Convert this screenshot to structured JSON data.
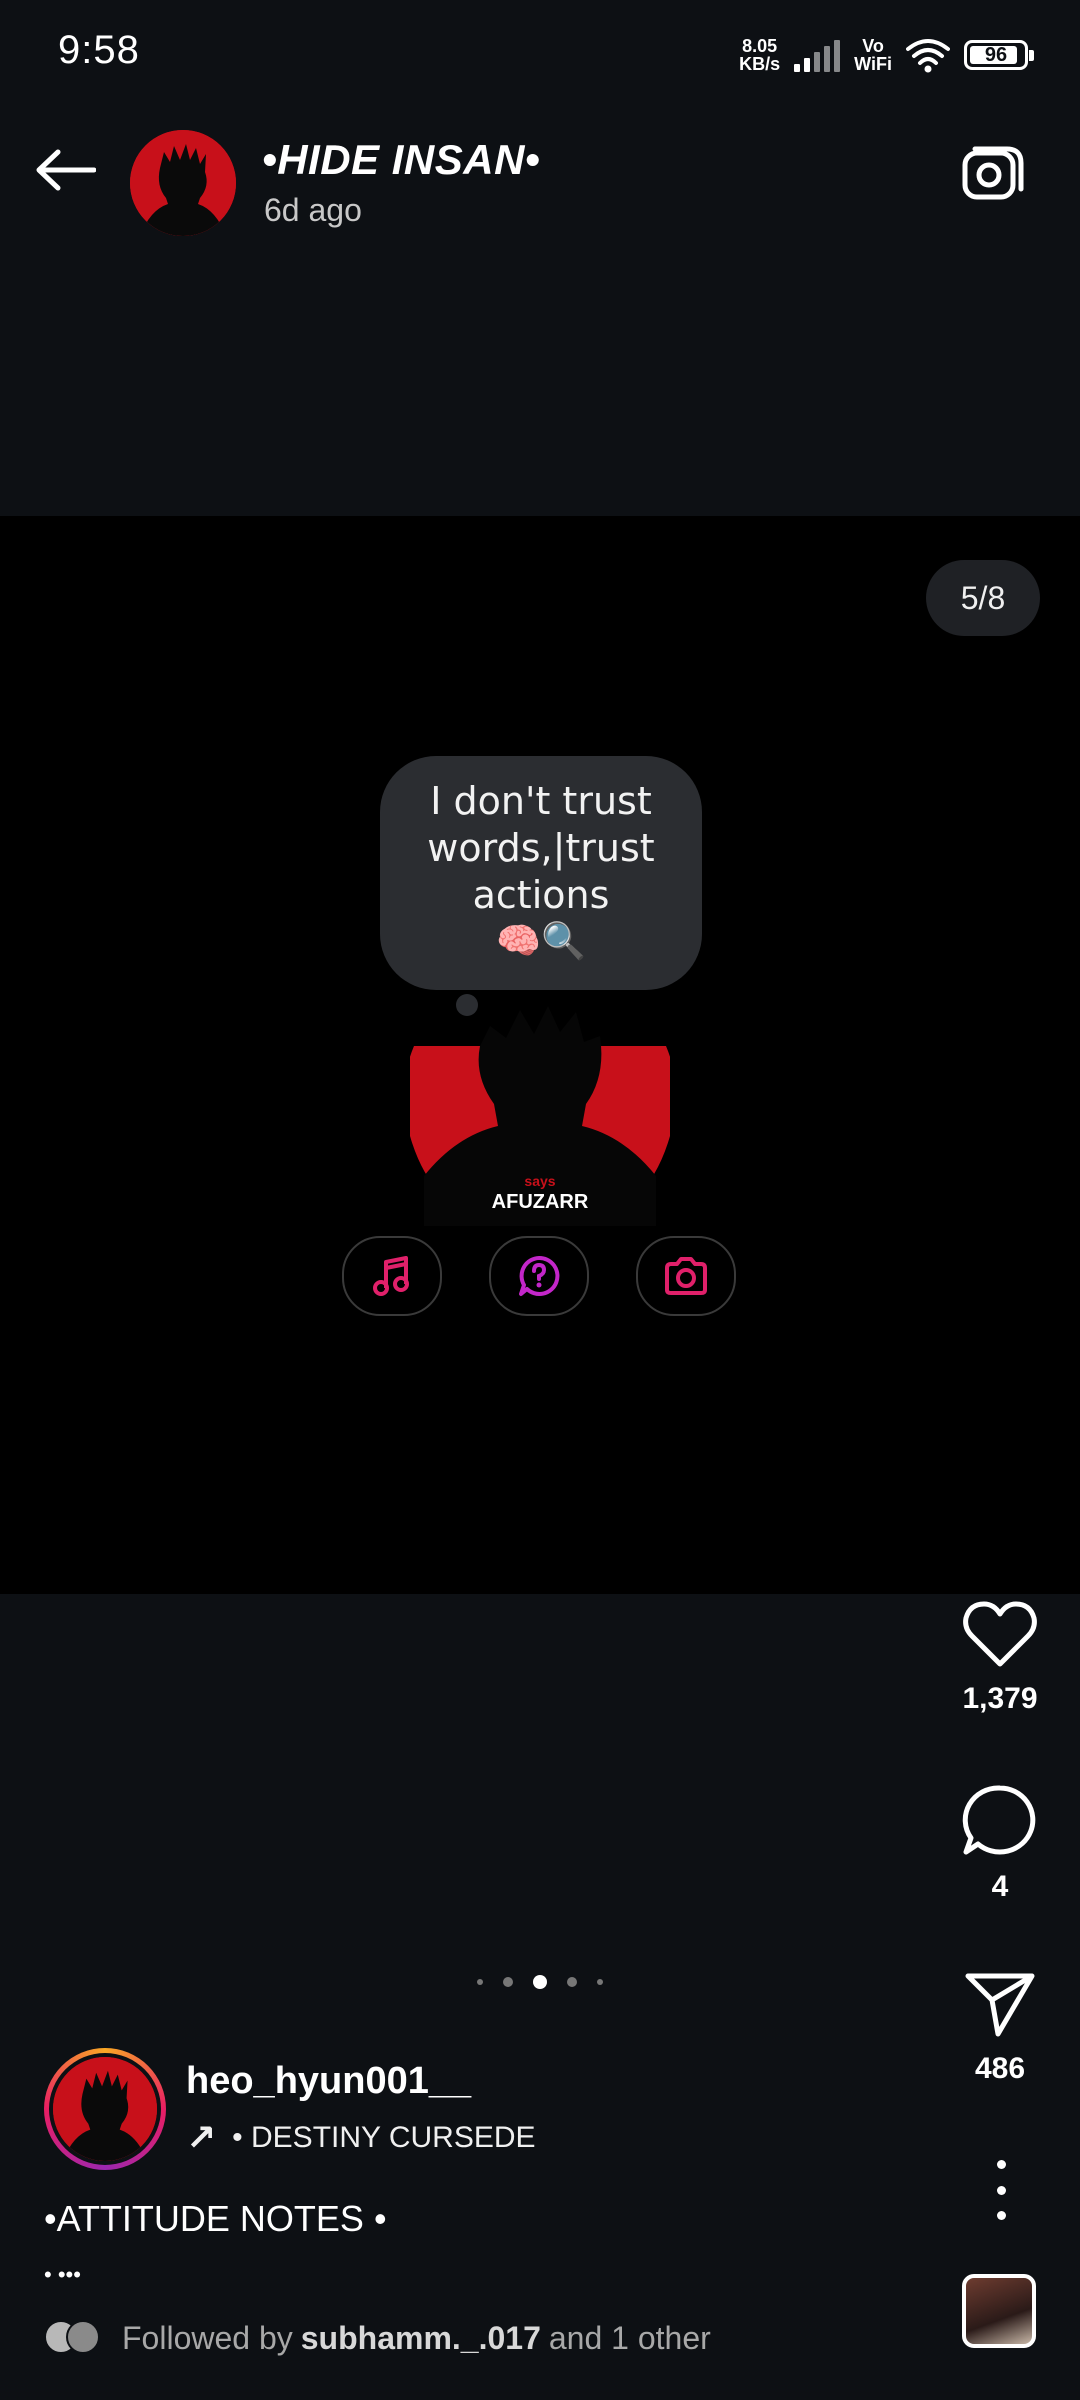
{
  "status_bar": {
    "time": "9:58",
    "net_speed_value": "8.05",
    "net_speed_unit": "KB/s",
    "vowifi_top": "Vo",
    "vowifi_bottom": "WiFi",
    "battery": "96"
  },
  "header": {
    "title": "•HIDE INSAN•",
    "timestamp": "6d ago"
  },
  "post": {
    "counter": "5/8",
    "note_text": "I don't trust words,|trust actions",
    "note_emoji": "🧠🔍",
    "avatar_caption": "AFUZARR",
    "avatar_top_caption": "says"
  },
  "actions": {
    "likes": "1,379",
    "comments": "4",
    "shares": "486"
  },
  "carousel": {
    "active_index": 2,
    "total_dots": 5
  },
  "caption": {
    "author": "heo_hyun001__",
    "music_arrow": "↗",
    "music_text": "• DESTINY    CURSEDE",
    "text": "•ATTITUDE NOTES •",
    "more": "• •••",
    "followed_prefix": "Followed by",
    "followed_user": "subhamm._.017",
    "followed_suffix": "and 1 other"
  },
  "colors": {
    "background": "#0d1014",
    "media_background": "#000000",
    "avatar_red": "#c8101a",
    "pill_icon_pink": "#e0206a",
    "pill_icon_purple": "#c326c9"
  }
}
